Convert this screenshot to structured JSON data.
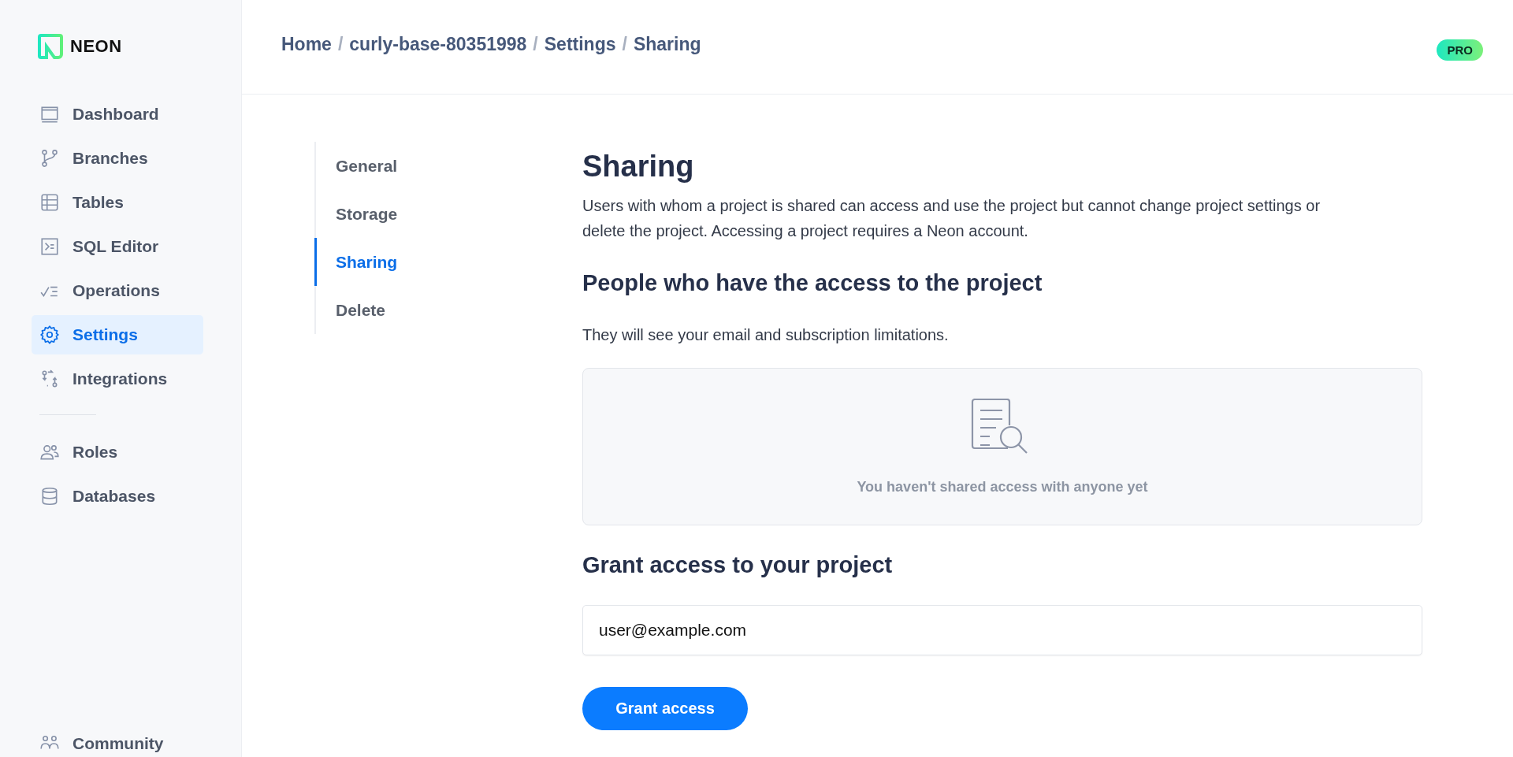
{
  "brand": {
    "name": "NEON"
  },
  "sidebar": {
    "items": [
      {
        "label": "Dashboard",
        "selected": false
      },
      {
        "label": "Branches",
        "selected": false
      },
      {
        "label": "Tables",
        "selected": false
      },
      {
        "label": "SQL Editor",
        "selected": false
      },
      {
        "label": "Operations",
        "selected": false
      },
      {
        "label": "Settings",
        "selected": true
      },
      {
        "label": "Integrations",
        "selected": false
      }
    ],
    "secondary_items": [
      {
        "label": "Roles",
        "selected": false
      },
      {
        "label": "Databases",
        "selected": false
      }
    ],
    "footer_item": {
      "label": "Community"
    }
  },
  "breadcrumb": {
    "separator": "/",
    "items": [
      "Home",
      "curly-base-80351998",
      "Settings",
      "Sharing"
    ]
  },
  "plan_badge": "PRO",
  "settings_nav": [
    {
      "label": "General",
      "selected": false
    },
    {
      "label": "Storage",
      "selected": false
    },
    {
      "label": "Sharing",
      "selected": true
    },
    {
      "label": "Delete",
      "selected": false
    }
  ],
  "content": {
    "title": "Sharing",
    "description": "Users with whom a project is shared can access and use the project but cannot change project settings or delete the project. Accessing a project requires a Neon account.",
    "people_heading": "People who have the access to the project",
    "people_note": "They will see your email and subscription limitations.",
    "empty_state": "You haven't shared access with anyone yet",
    "grant_heading": "Grant access to your project",
    "email_field": {
      "value": "user@example.com"
    },
    "grant_button": "Grant access"
  }
}
